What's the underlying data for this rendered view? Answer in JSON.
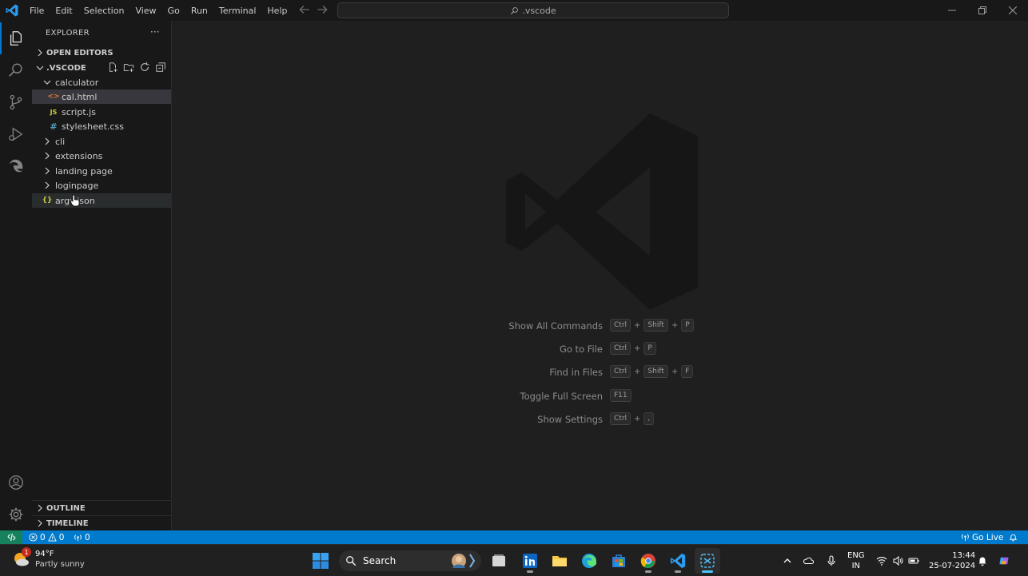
{
  "menu": [
    "File",
    "Edit",
    "Selection",
    "View",
    "Go",
    "Run",
    "Terminal",
    "Help"
  ],
  "command_center": {
    "text": ".vscode"
  },
  "sidebar": {
    "title": "EXPLORER",
    "more": "···",
    "open_editors": "OPEN EDITORS",
    "folder_name": ".VSCODE",
    "tree": [
      {
        "label": "calculator",
        "type": "folder",
        "expanded": true
      },
      {
        "label": "cal.html",
        "type": "html",
        "icon": "<>"
      },
      {
        "label": "script.js",
        "type": "js",
        "icon": "JS"
      },
      {
        "label": "stylesheet.css",
        "type": "css",
        "icon": "#"
      },
      {
        "label": "cli",
        "type": "folder"
      },
      {
        "label": "extensions",
        "type": "folder"
      },
      {
        "label": "landing page",
        "type": "folder"
      },
      {
        "label": "loginpage",
        "type": "folder"
      },
      {
        "label": "argv.json",
        "type": "json",
        "icon": "{}"
      }
    ],
    "outline": "OUTLINE",
    "timeline": "TIMELINE"
  },
  "shortcuts": [
    {
      "label": "Show All Commands",
      "keys": [
        "Ctrl",
        "Shift",
        "P"
      ]
    },
    {
      "label": "Go to File",
      "keys": [
        "Ctrl",
        "P"
      ]
    },
    {
      "label": "Find in Files",
      "keys": [
        "Ctrl",
        "Shift",
        "F"
      ]
    },
    {
      "label": "Toggle Full Screen",
      "keys": [
        "F11"
      ]
    },
    {
      "label": "Show Settings",
      "keys": [
        "Ctrl",
        ","
      ]
    }
  ],
  "status": {
    "errors": "0",
    "warnings": "0",
    "ports": "0",
    "go_live": "Go Live"
  },
  "taskbar": {
    "weather_temp": "94°F",
    "weather_desc": "Partly sunny",
    "weather_badge": "1",
    "search": "Search",
    "lang_top": "ENG",
    "lang_bottom": "IN",
    "time": "13:44",
    "date": "25-07-2024"
  },
  "colors": {
    "accent": "#007acc",
    "html": "#e37933",
    "js": "#cbcb41",
    "css": "#519aba",
    "json": "#cbcb41"
  }
}
